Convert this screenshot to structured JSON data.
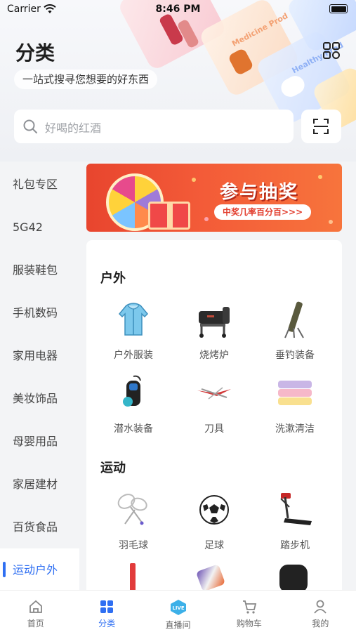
{
  "status_bar": {
    "carrier": "Carrier",
    "time": "8:46 PM"
  },
  "header": {
    "title": "分类",
    "subtitle": "一站式搜寻您想要的好东西",
    "decor_labels": [
      "Medicine Prod",
      "Healthy Prod"
    ]
  },
  "search": {
    "placeholder": "好喝的红酒"
  },
  "sidebar": {
    "items": [
      {
        "label": "礼包专区",
        "active": false
      },
      {
        "label": "5G42",
        "active": false
      },
      {
        "label": "服装鞋包",
        "active": false
      },
      {
        "label": "手机数码",
        "active": false
      },
      {
        "label": "家用电器",
        "active": false
      },
      {
        "label": "美妆饰品",
        "active": false
      },
      {
        "label": "母婴用品",
        "active": false
      },
      {
        "label": "家居建材",
        "active": false
      },
      {
        "label": "百货食品",
        "active": false
      },
      {
        "label": "运动户外",
        "active": true
      }
    ]
  },
  "banner": {
    "title": "参与抽奖",
    "tagline": "中奖几率百分百>>>"
  },
  "sections": [
    {
      "title": "户外",
      "items": [
        {
          "label": "户外服装",
          "icon": "jacket-icon"
        },
        {
          "label": "烧烤炉",
          "icon": "grill-icon"
        },
        {
          "label": "垂钓装备",
          "icon": "fishing-rod-icon"
        },
        {
          "label": "潜水装备",
          "icon": "dive-gear-icon"
        },
        {
          "label": "刀具",
          "icon": "knife-icon"
        },
        {
          "label": "洗漱清洁",
          "icon": "towel-icon"
        }
      ]
    },
    {
      "title": "运动",
      "items": [
        {
          "label": "羽毛球",
          "icon": "badminton-icon"
        },
        {
          "label": "足球",
          "icon": "football-icon"
        },
        {
          "label": "踏步机",
          "icon": "treadmill-icon"
        }
      ]
    }
  ],
  "tabbar": {
    "tabs": [
      {
        "label": "首页",
        "icon": "home-icon",
        "active": false
      },
      {
        "label": "分类",
        "icon": "category-icon",
        "active": true
      },
      {
        "label": "直播间",
        "icon": "live-icon",
        "active": false
      },
      {
        "label": "购物车",
        "icon": "cart-icon",
        "active": false
      },
      {
        "label": "我的",
        "icon": "profile-icon",
        "active": false
      }
    ]
  },
  "colors": {
    "accent": "#2f6ff2",
    "banner_red": "#e8452e"
  }
}
